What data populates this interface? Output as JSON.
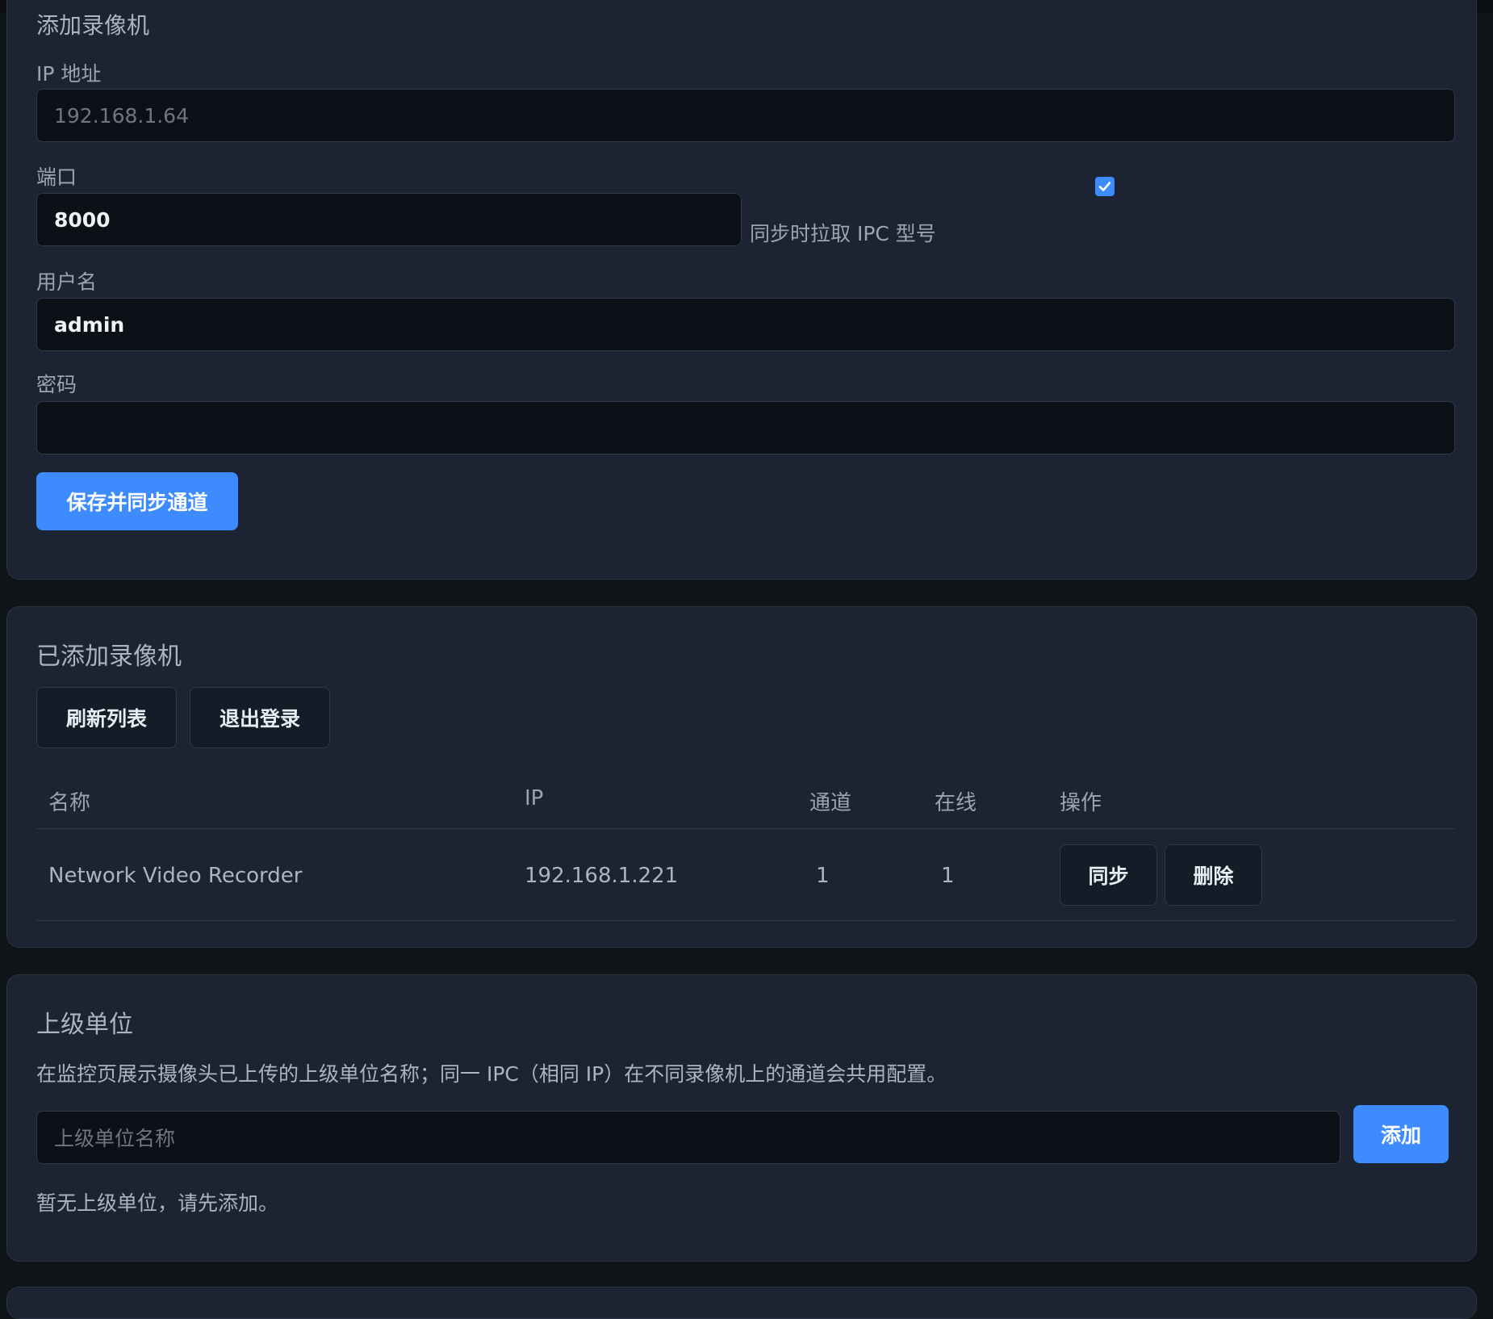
{
  "add_recorder": {
    "title": "添加录像机",
    "ip_label": "IP 地址",
    "ip_placeholder": "192.168.1.64",
    "port_label": "端口",
    "port_value": "8000",
    "sync_ipc_model_label": "同步时拉取 IPC 型号",
    "sync_ipc_model_checked": true,
    "username_label": "用户名",
    "username_value": "admin",
    "password_label": "密码",
    "password_value": "",
    "save_button": "保存并同步通道"
  },
  "added_recorders": {
    "title": "已添加录像机",
    "refresh_button": "刷新列表",
    "logout_button": "退出登录",
    "columns": [
      "名称",
      "IP",
      "通道",
      "在线",
      "操作"
    ],
    "rows": [
      {
        "name": "Network Video Recorder",
        "ip": "192.168.1.221",
        "channels": "1",
        "online": "1",
        "sync_button": "同步",
        "delete_button": "删除"
      }
    ]
  },
  "parent_units": {
    "title": "上级单位",
    "description": "在监控页展示摄像头已上传的上级单位名称；同一 IPC（相同 IP）在不同录像机上的通道会共用配置。",
    "input_placeholder": "上级单位名称",
    "add_button": "添加",
    "empty_text": "暂无上级单位，请先添加。"
  },
  "colors": {
    "accent": "#3d8bfd",
    "card_bg": "#1c2433",
    "page_bg": "#0f1419",
    "input_bg": "#0d1117"
  },
  "icons": {
    "checkbox": "check-icon"
  }
}
